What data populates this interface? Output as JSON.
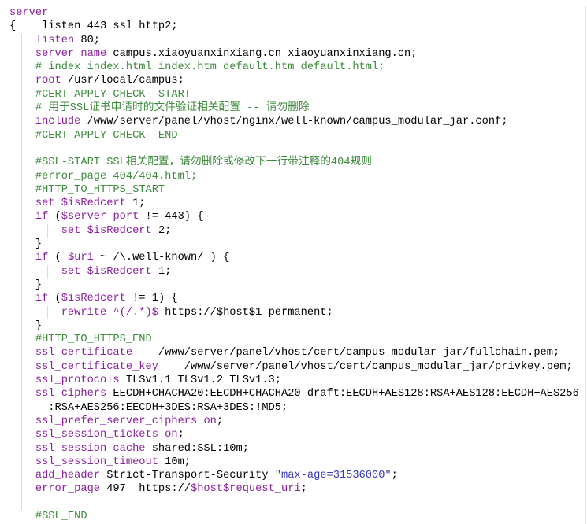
{
  "colors": {
    "kw": "#8b229f",
    "cm": "#3d8b3d",
    "str": "#3535b5",
    "t": "#000000"
  },
  "lines": [
    [
      {
        "kw": "server"
      }
    ],
    [
      {
        "t": "{    listen 443 ssl http2;"
      }
    ],
    [
      {
        "t": "    "
      },
      {
        "kw": "listen"
      },
      {
        "t": " 80;"
      }
    ],
    [
      {
        "t": "    "
      },
      {
        "kw": "server_name"
      },
      {
        "t": " campus.xiaoyuanxinxiang.cn xiaoyuanxinxiang.cn;"
      }
    ],
    [
      {
        "t": "    "
      },
      {
        "cm": "# index index.html index.htm default.htm default.html;"
      }
    ],
    [
      {
        "t": "    "
      },
      {
        "kw": "root"
      },
      {
        "t": " /usr/local/campus;"
      }
    ],
    [
      {
        "t": "    "
      },
      {
        "cm": "#CERT-APPLY-CHECK--START"
      }
    ],
    [
      {
        "t": "    "
      },
      {
        "cm": "# 用于SSL证书申请时的文件验证相关配置 -- 请勿删除"
      }
    ],
    [
      {
        "t": "    "
      },
      {
        "kw": "include"
      },
      {
        "t": " /www/server/panel/vhost/nginx/well-known/campus_modular_jar.conf;"
      }
    ],
    [
      {
        "t": "    "
      },
      {
        "cm": "#CERT-APPLY-CHECK--END"
      }
    ],
    [],
    [
      {
        "t": "    "
      },
      {
        "cm": "#SSL-START SSL相关配置，请勿删除或修改下一行带注释的404规则"
      }
    ],
    [
      {
        "t": "    "
      },
      {
        "cm": "#error_page 404/404.html;"
      }
    ],
    [
      {
        "t": "    "
      },
      {
        "cm": "#HTTP_TO_HTTPS_START"
      }
    ],
    [
      {
        "t": "    "
      },
      {
        "kw": "set"
      },
      {
        "t": " "
      },
      {
        "kw": "$isRedcert"
      },
      {
        "t": " 1;"
      }
    ],
    [
      {
        "t": "    "
      },
      {
        "kw": "if"
      },
      {
        "t": " ("
      },
      {
        "kw": "$server_port"
      },
      {
        "t": " != 443) {"
      }
    ],
    [
      {
        "t": "        "
      },
      {
        "kw": "set"
      },
      {
        "t": " "
      },
      {
        "kw": "$isRedcert"
      },
      {
        "t": " 2;"
      }
    ],
    [
      {
        "t": "    }"
      }
    ],
    [
      {
        "t": "    "
      },
      {
        "kw": "if"
      },
      {
        "t": " ( "
      },
      {
        "kw": "$uri"
      },
      {
        "t": " ~ /\\.well-known/ ) {"
      }
    ],
    [
      {
        "t": "        "
      },
      {
        "kw": "set"
      },
      {
        "t": " "
      },
      {
        "kw": "$isRedcert"
      },
      {
        "t": " 1;"
      }
    ],
    [
      {
        "t": "    }"
      }
    ],
    [
      {
        "t": "    "
      },
      {
        "kw": "if"
      },
      {
        "t": " ("
      },
      {
        "kw": "$isRedcert"
      },
      {
        "t": " != 1) {"
      }
    ],
    [
      {
        "t": "        "
      },
      {
        "kw": "rewrite"
      },
      {
        "t": " "
      },
      {
        "kw": "^(/.*)$"
      },
      {
        "t": " https://$host$1 permanent;"
      }
    ],
    [
      {
        "t": "    }"
      }
    ],
    [
      {
        "t": "    "
      },
      {
        "cm": "#HTTP_TO_HTTPS_END"
      }
    ],
    [
      {
        "t": "    "
      },
      {
        "kw": "ssl_certificate"
      },
      {
        "t": "    /www/server/panel/vhost/cert/campus_modular_jar/fullchain.pem;"
      }
    ],
    [
      {
        "t": "    "
      },
      {
        "kw": "ssl_certificate_key"
      },
      {
        "t": "    /www/server/panel/vhost/cert/campus_modular_jar/privkey.pem;"
      }
    ],
    [
      {
        "t": "    "
      },
      {
        "kw": "ssl_protocols"
      },
      {
        "t": " TLSv1.1 TLSv1.2 TLSv1.3;"
      }
    ],
    [
      {
        "t": "    "
      },
      {
        "kw": "ssl_ciphers"
      },
      {
        "t": " EECDH+CHACHA20:EECDH+CHACHA20-draft:EECDH+AES128:RSA+AES128:EECDH+AES256"
      }
    ],
    [
      {
        "t": "      :RSA+AES256:EECDH+3DES:RSA+3DES:!MD5;"
      }
    ],
    [
      {
        "t": "    "
      },
      {
        "kw": "ssl_prefer_server_ciphers"
      },
      {
        "t": " "
      },
      {
        "kw": "on"
      },
      {
        "t": ";"
      }
    ],
    [
      {
        "t": "    "
      },
      {
        "kw": "ssl_session_tickets"
      },
      {
        "t": " "
      },
      {
        "kw": "on"
      },
      {
        "t": ";"
      }
    ],
    [
      {
        "t": "    "
      },
      {
        "kw": "ssl_session_cache"
      },
      {
        "t": " shared:SSL:10m;"
      }
    ],
    [
      {
        "t": "    "
      },
      {
        "kw": "ssl_session_timeout"
      },
      {
        "t": " 10m;"
      }
    ],
    [
      {
        "t": "    "
      },
      {
        "kw": "add_header"
      },
      {
        "t": " Strict-Transport-Security "
      },
      {
        "str": "\"max-age=31536000\""
      },
      {
        "t": ";"
      }
    ],
    [
      {
        "t": "    "
      },
      {
        "kw": "error_page"
      },
      {
        "t": " 497  https://"
      },
      {
        "kw": "$host$request_uri"
      },
      {
        "t": ";"
      }
    ],
    [],
    [
      {
        "t": "    "
      },
      {
        "cm": "#SSL_END"
      }
    ]
  ]
}
